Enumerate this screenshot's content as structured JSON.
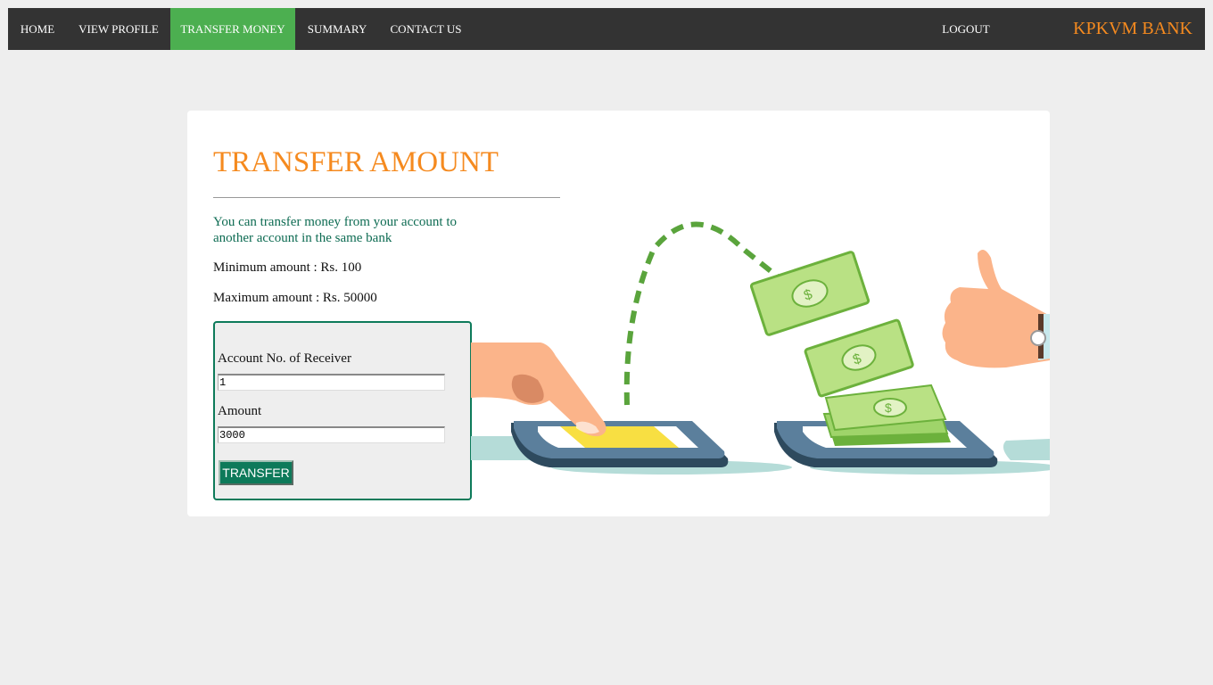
{
  "nav": {
    "items": [
      {
        "label": "HOME",
        "active": false
      },
      {
        "label": "VIEW PROFILE",
        "active": false
      },
      {
        "label": "TRANSFER MONEY",
        "active": true
      },
      {
        "label": "SUMMARY",
        "active": false
      },
      {
        "label": "CONTACT US",
        "active": false
      }
    ],
    "logout": "LOGOUT",
    "brand": "KPKVM BANK"
  },
  "page": {
    "title": "TRANSFER AMOUNT",
    "intro": "You can transfer money from your account to another account in the same bank",
    "min_amount": "Minimum amount : Rs. 100",
    "max_amount": "Maximum amount : Rs. 50000"
  },
  "form": {
    "account_label": "Account No. of Receiver",
    "account_value": "1",
    "amount_label": "Amount",
    "amount_value": "3000",
    "submit_label": "TRANSFER"
  },
  "colors": {
    "nav_bg": "#333333",
    "nav_active": "#4caf50",
    "brand": "#f58a1f",
    "accent_green": "#0d7a5a",
    "page_bg": "#eeeeee"
  },
  "illustration": {
    "icons": [
      "pointing-hand-icon",
      "phone-icon",
      "money-bill-icon",
      "thumbs-up-icon"
    ]
  }
}
